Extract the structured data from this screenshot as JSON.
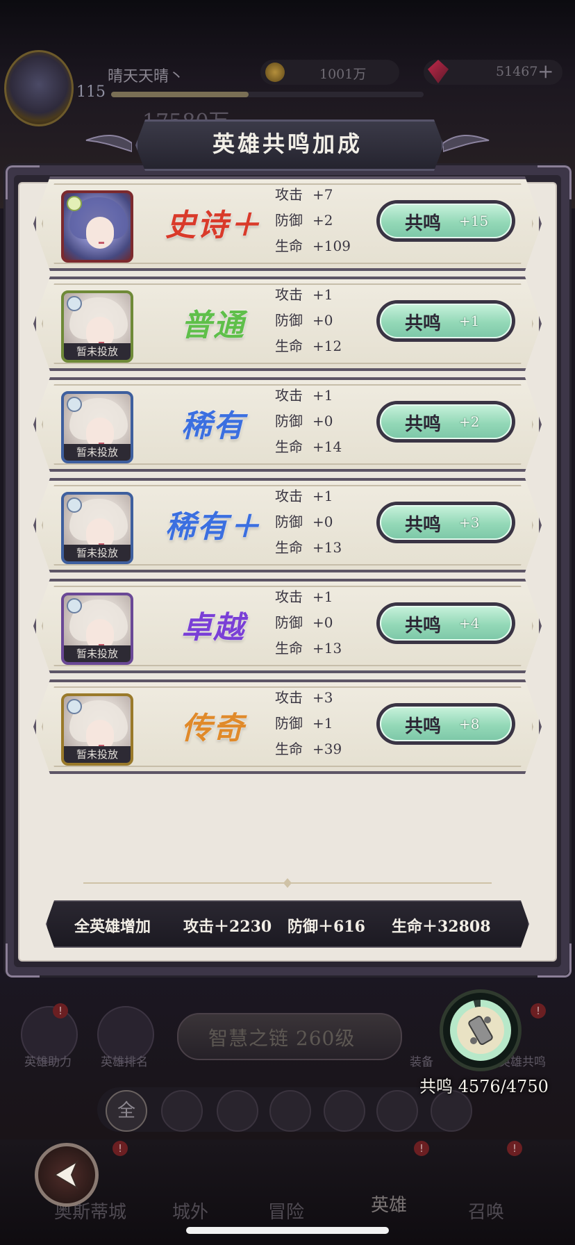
{
  "player": {
    "name": "晴天天晴丶",
    "level": "115",
    "power": "17580万",
    "gold": "1001万",
    "gems": "51467"
  },
  "modal": {
    "title": "英雄共鸣加成",
    "rows": [
      {
        "rarity": "史诗＋",
        "rarity_color": "#d93a2a",
        "attack_label": "攻击",
        "attack": "+7",
        "defense_label": "防御",
        "defense": "+2",
        "hp_label": "生命",
        "hp": "+109",
        "button_label": "共鸣",
        "button_value": "+15",
        "placed": true,
        "frame_color": "#7c2a2e"
      },
      {
        "rarity": "普通",
        "rarity_color": "#5fbf4a",
        "attack_label": "攻击",
        "attack": "+1",
        "defense_label": "防御",
        "defense": "+0",
        "hp_label": "生命",
        "hp": "+12",
        "button_label": "共鸣",
        "button_value": "+1",
        "placed": false,
        "unplaced_label": "暂未投放",
        "frame_color": "#6f8a38"
      },
      {
        "rarity": "稀有",
        "rarity_color": "#3b6fe0",
        "attack_label": "攻击",
        "attack": "+1",
        "defense_label": "防御",
        "defense": "+0",
        "hp_label": "生命",
        "hp": "+14",
        "button_label": "共鸣",
        "button_value": "+2",
        "placed": false,
        "unplaced_label": "暂未投放",
        "frame_color": "#3e5f9e"
      },
      {
        "rarity": "稀有＋",
        "rarity_color": "#3b6fe0",
        "attack_label": "攻击",
        "attack": "+1",
        "defense_label": "防御",
        "defense": "+0",
        "hp_label": "生命",
        "hp": "+13",
        "button_label": "共鸣",
        "button_value": "+3",
        "placed": false,
        "unplaced_label": "暂未投放",
        "frame_color": "#3e5f9e"
      },
      {
        "rarity": "卓越",
        "rarity_color": "#7a3fd6",
        "attack_label": "攻击",
        "attack": "+1",
        "defense_label": "防御",
        "defense": "+0",
        "hp_label": "生命",
        "hp": "+13",
        "button_label": "共鸣",
        "button_value": "+4",
        "placed": false,
        "unplaced_label": "暂未投放",
        "frame_color": "#6a4896"
      },
      {
        "rarity": "传奇",
        "rarity_color": "#e08a2a",
        "attack_label": "攻击",
        "attack": "+3",
        "defense_label": "防御",
        "defense": "+1",
        "hp_label": "生命",
        "hp": "+39",
        "button_label": "共鸣",
        "button_value": "+8",
        "placed": false,
        "unplaced_label": "暂未投放",
        "frame_color": "#9a7a2a"
      }
    ],
    "totals": {
      "label": "全英雄增加",
      "attack": "攻击＋2230",
      "defense": "防御＋616",
      "hp": "生命＋32808"
    }
  },
  "underlay": {
    "side_buttons": [
      "英雄助力",
      "英雄排名",
      "装备",
      "英雄共鸣"
    ],
    "chain": "智慧之链 260级",
    "filter_all": "全",
    "resonance": "共鸣 4576/4750",
    "resonance_progress": 0.963,
    "tabs": [
      "奥斯蒂城",
      "城外",
      "冒险",
      "英雄",
      "召唤"
    ],
    "notice": "!"
  }
}
